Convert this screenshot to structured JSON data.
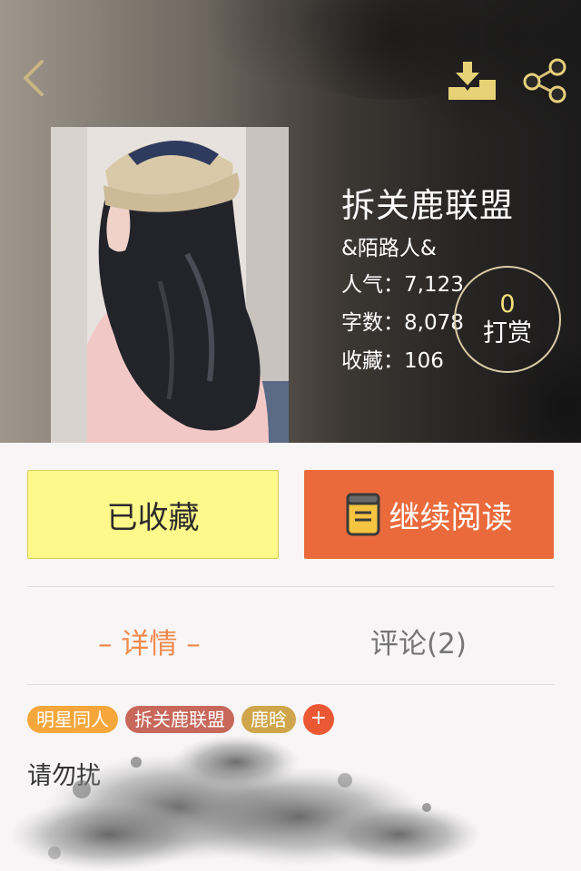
{
  "header": {
    "back_icon": "chevron-left-icon",
    "download_icon": "download-tray-icon",
    "share_icon": "share-icon"
  },
  "book": {
    "title": "拆关鹿联盟",
    "author": "&陌路人&",
    "popularity_label": "人气：",
    "popularity_value": "7,123",
    "words_label": "字数：",
    "words_value": "8,078",
    "favorites_label": "收藏：",
    "favorites_value": "106"
  },
  "tip": {
    "count": "0",
    "label": "打赏"
  },
  "actions": {
    "favorited_label": "已收藏",
    "continue_label": "继续阅读"
  },
  "tabs": {
    "detail": "– 详情 –",
    "comments": "评论(2)"
  },
  "tags": [
    "明星同人",
    "拆关鹿联盟",
    "鹿晗"
  ],
  "tag_add": "+",
  "description": {
    "line1": "请勿扰",
    "line2": "",
    "line3": ""
  },
  "colors": {
    "accent_orange": "#ea6a3c",
    "favorite_yellow": "#fff88a",
    "tab_active": "#f08a4b"
  }
}
